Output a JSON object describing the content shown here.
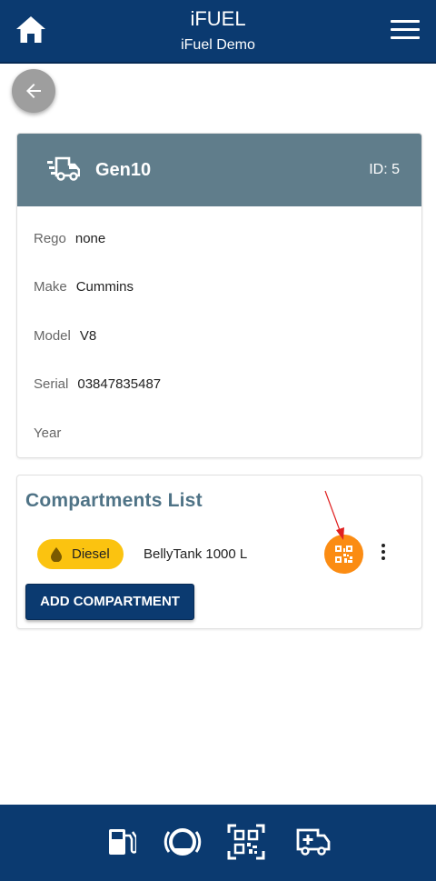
{
  "header": {
    "title": "iFUEL",
    "subtitle": "iFuel Demo",
    "home_icon": "home-icon",
    "menu_icon": "hamburger-menu-icon"
  },
  "back_button": {
    "icon": "arrow-left-icon"
  },
  "asset": {
    "icon": "truck-icon",
    "name": "Gen10",
    "id_label": "ID: 5",
    "fields": [
      {
        "label": "Rego",
        "value": "none"
      },
      {
        "label": "Make",
        "value": "Cummins"
      },
      {
        "label": "Model",
        "value": "V8"
      },
      {
        "label": "Serial",
        "value": "03847835487"
      },
      {
        "label": "Year",
        "value": ""
      }
    ]
  },
  "compartments": {
    "title": "Compartments List",
    "items": [
      {
        "fuel_type": "Diesel",
        "fuel_icon": "fuel-drop-icon",
        "name": "BellyTank 1000 L",
        "qr_icon": "qr-code-icon",
        "more_icon": "more-vertical-icon"
      }
    ],
    "add_label": "ADD COMPARTMENT"
  },
  "bottom_nav": [
    "fuel-pump-icon",
    "gauge-icon",
    "qr-scan-icon",
    "vehicle-add-icon"
  ],
  "colors": {
    "primary": "#0b3a70",
    "asset_header": "#607d8b",
    "section_title": "#4f7386",
    "fuel_chip": "#fbc310",
    "qr_button": "#fb8c13",
    "annotation_arrow": "#e02020"
  }
}
